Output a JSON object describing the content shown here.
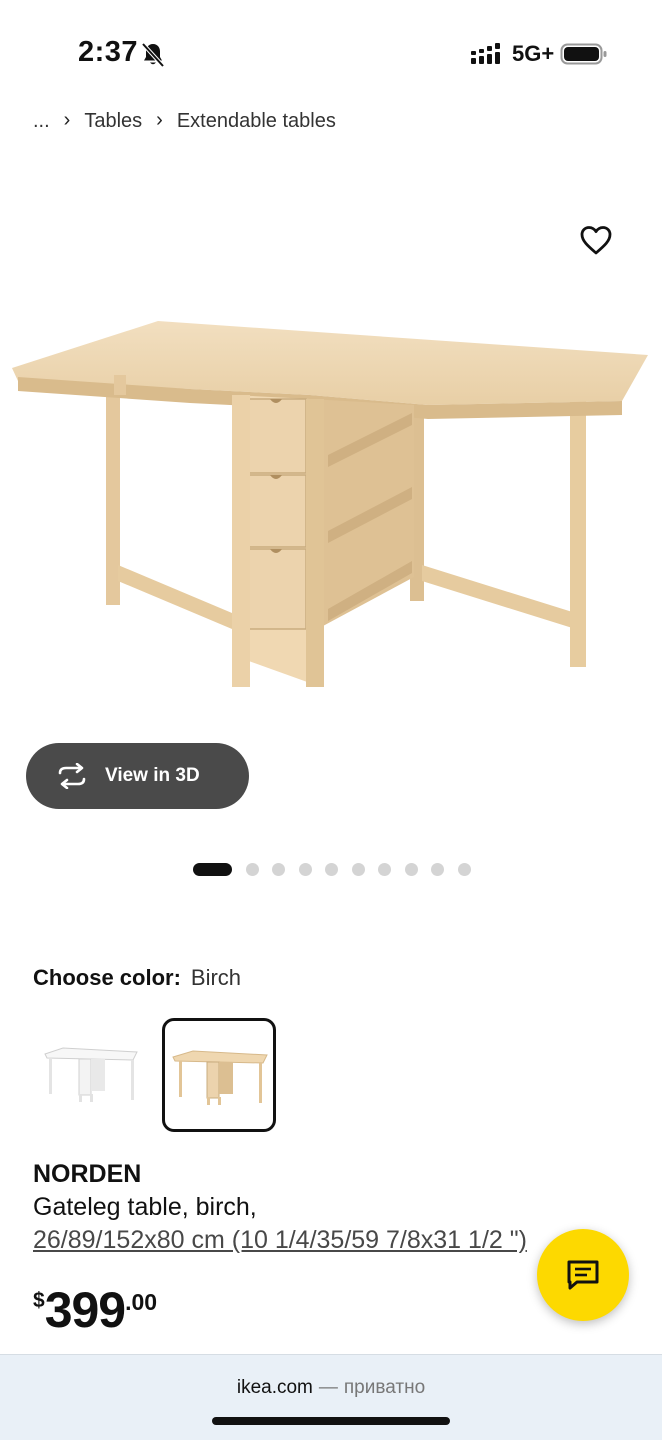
{
  "status_bar": {
    "time": "2:37",
    "network": "5G+",
    "icons": [
      "bell-slash-icon",
      "signal-icon",
      "battery-icon"
    ]
  },
  "breadcrumb": {
    "ellipsis": "...",
    "items": [
      "Tables",
      "Extendable tables"
    ]
  },
  "gallery": {
    "view_3d_label": "View in 3D",
    "dot_count": 10,
    "active_index": 0
  },
  "color": {
    "label": "Choose color:",
    "selected": "Birch",
    "options": [
      "White",
      "Birch"
    ]
  },
  "product": {
    "name": "NORDEN",
    "description": "Gateleg table, birch,",
    "dimensions": "26/89/152x80 cm (10 1/4/35/59 7/8x31 1/2 \")"
  },
  "price": {
    "currency": "$",
    "integer": "399",
    "decimals": ".00"
  },
  "url_bar": {
    "domain": "ikea.com",
    "separator": "—",
    "mode": "приватно"
  },
  "colors": {
    "chat_button": "#fdd900",
    "view3d_button": "#4a4a4a",
    "url_bar_bg": "#e9f0f7",
    "birch_wood": "#ecd3ad"
  }
}
